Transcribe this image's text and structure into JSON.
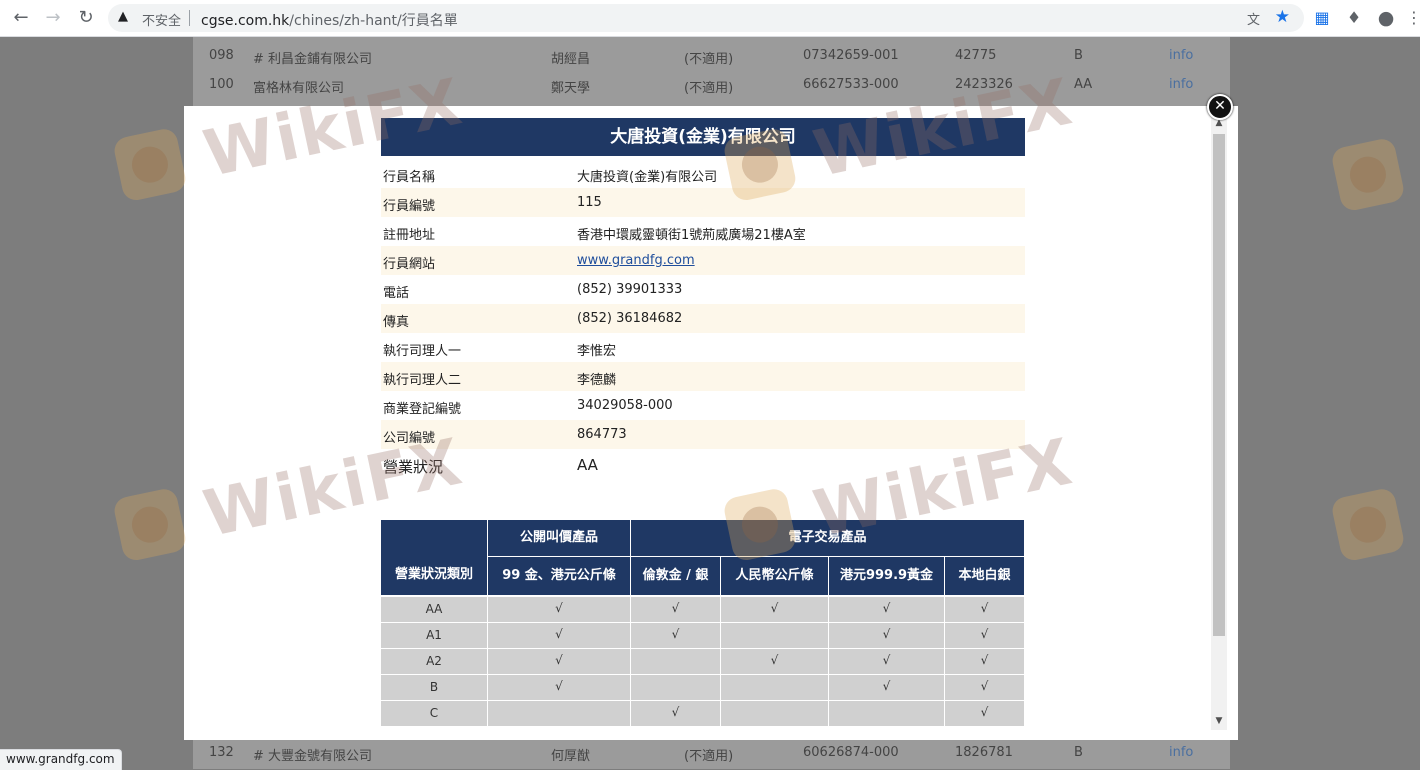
{
  "browser": {
    "insecure_label": "不安全",
    "url_host": "cgse.com.hk",
    "url_path": "/chines/zh-hant/行員名單"
  },
  "background_rows": [
    {
      "no": "098",
      "name": "# 利昌金鋪有限公司",
      "person": "胡經昌",
      "tag": "(不適用)",
      "phone": "07342659-001",
      "code": "42775",
      "grade": "B",
      "link": "info"
    },
    {
      "no": "100",
      "name": "富格林有限公司",
      "person": "鄭天學",
      "tag": "(不適用)",
      "phone": "66627533-000",
      "code": "2423326",
      "grade": "AA",
      "link": "info"
    },
    {
      "no": "132",
      "name": "# 大豐金號有限公司",
      "person": "何厚猷",
      "tag": "(不適用)",
      "phone": "60626874-000",
      "code": "1826781",
      "grade": "B",
      "link": "info"
    }
  ],
  "modal": {
    "title": "大唐投資(金業)有限公司",
    "fields": [
      {
        "label": "行員名稱",
        "value": "大唐投資(金業)有限公司"
      },
      {
        "label": "行員編號",
        "value": "115"
      },
      {
        "label": "註冊地址",
        "value": "香港中環威靈頓街1號荊威廣場21樓A室"
      },
      {
        "label": "行員網站",
        "value": "www.grandfg.com"
      },
      {
        "label": "電話",
        "value": "(852) 39901333"
      },
      {
        "label": "傳真",
        "value": "(852) 36184682"
      },
      {
        "label": "執行司理人一",
        "value": "李惟宏"
      },
      {
        "label": "執行司理人二",
        "value": "李德麟"
      },
      {
        "label": "商業登記編號",
        "value": "34029058-000"
      },
      {
        "label": "公司編號",
        "value": "864773"
      },
      {
        "label": "營業狀況",
        "value": "AA"
      }
    ],
    "status_table": {
      "col_header": "營業狀況類別",
      "group_public": "公開叫價產品",
      "group_electronic": "電子交易產品",
      "columns": [
        "99 金、港元公斤條",
        "倫敦金 / 銀",
        "人民幣公斤條",
        "港元999.9黃金",
        "本地白銀"
      ],
      "rows": [
        {
          "category": "AA",
          "marks": [
            "√",
            "√",
            "√",
            "√",
            "√"
          ]
        },
        {
          "category": "A1",
          "marks": [
            "√",
            "√",
            "",
            "√",
            "√"
          ]
        },
        {
          "category": "A2",
          "marks": [
            "√",
            "",
            "√",
            "√",
            "√"
          ]
        },
        {
          "category": "B",
          "marks": [
            "√",
            "",
            "",
            "√",
            "√"
          ]
        },
        {
          "category": "C",
          "marks": [
            "",
            "√",
            "",
            "",
            "√"
          ]
        }
      ]
    }
  },
  "watermark": {
    "text": "WikiFX"
  },
  "status_bar": {
    "text": "www.grandfg.com"
  },
  "colors": {
    "header_navy": "#1f3864",
    "row_cream": "#fdf7ea",
    "cell_gray": "#d0d0d0",
    "star_blue": "#1a73e8"
  }
}
